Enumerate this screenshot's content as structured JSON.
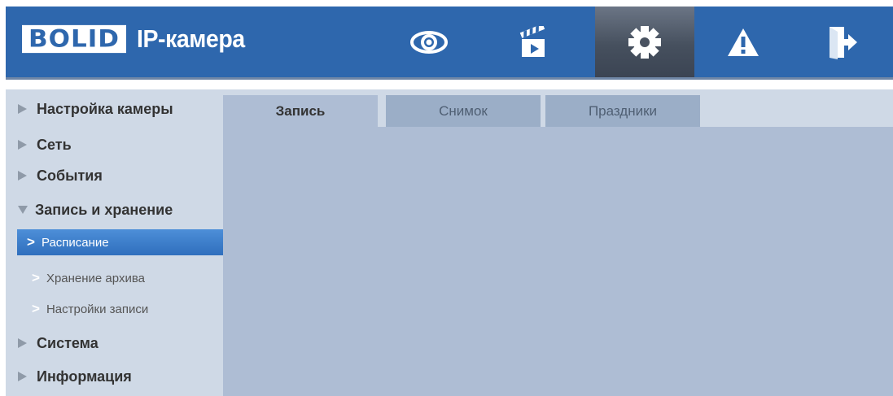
{
  "header": {
    "logo_brand": "BOLID",
    "logo_text": "IP-камера",
    "nav": [
      {
        "icon": "eye-icon",
        "label": "Просмотр"
      },
      {
        "icon": "clapperboard-icon",
        "label": "Воспроизведение"
      },
      {
        "icon": "gear-icon",
        "label": "Настройка",
        "active": true
      },
      {
        "icon": "warning-icon",
        "label": "Тревога"
      },
      {
        "icon": "logout-icon",
        "label": "Выход"
      }
    ],
    "colors": {
      "bar": "#2e67ad",
      "active_button": "#4b5563"
    }
  },
  "sidebar": {
    "items": [
      {
        "label": "Настройка камеры"
      },
      {
        "label": "Сеть"
      },
      {
        "label": "События"
      },
      {
        "label": "Запись и хранение",
        "expanded": true,
        "children": [
          {
            "label": "Расписание",
            "active": true
          },
          {
            "label": "Хранение архива"
          },
          {
            "label": "Настройки записи"
          }
        ]
      },
      {
        "label": "Система"
      },
      {
        "label": "Информация"
      }
    ]
  },
  "tabs": [
    {
      "label": "Запись",
      "active": true
    },
    {
      "label": "Снимок"
    },
    {
      "label": "Праздники"
    }
  ]
}
